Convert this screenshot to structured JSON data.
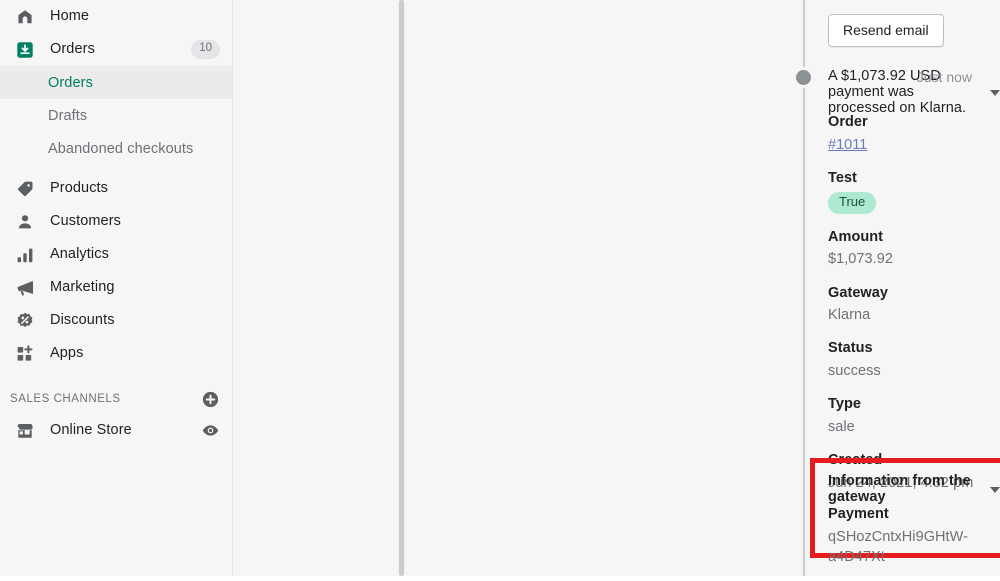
{
  "colors": {
    "sidebar_bg": "#f6f6f7",
    "accent_green": "#008060",
    "highlight_red": "#e81c1c",
    "badge_green": "#aee9d1",
    "link_blue": "#6b7bb5",
    "muted_text": "#6d7175"
  },
  "sidebar": {
    "items": [
      {
        "label": "Home",
        "icon": "home-icon",
        "badge": null
      },
      {
        "label": "Orders",
        "icon": "orders-inbox-icon",
        "badge": "10"
      },
      {
        "label": "Products",
        "icon": "products-tag-icon",
        "badge": null
      },
      {
        "label": "Customers",
        "icon": "customers-person-icon",
        "badge": null
      },
      {
        "label": "Analytics",
        "icon": "analytics-bars-icon",
        "badge": null
      },
      {
        "label": "Marketing",
        "icon": "marketing-megaphone-icon",
        "badge": null
      },
      {
        "label": "Discounts",
        "icon": "discounts-percent-icon",
        "badge": null
      },
      {
        "label": "Apps",
        "icon": "apps-grid-plus-icon",
        "badge": null
      }
    ],
    "sub_items": [
      {
        "label": "Orders",
        "active": true
      },
      {
        "label": "Drafts",
        "active": false
      },
      {
        "label": "Abandoned checkouts",
        "active": false
      }
    ],
    "sales_channels": {
      "title": "SALES CHANNELS",
      "add_icon": "plus-circle-icon",
      "items": [
        {
          "label": "Online Store",
          "icon": "online-store-shop-icon",
          "action_icon": "eye-icon"
        }
      ]
    }
  },
  "main": {
    "resend_button": "Resend email",
    "event": {
      "text": "A $1,073.92 USD payment was processed on Klarna.",
      "disclosure_icon": "chevron-down-icon",
      "timestamp": "Just now"
    },
    "fields": [
      {
        "label": "Order",
        "value": "#1011",
        "kind": "link"
      },
      {
        "label": "Test",
        "value": "True",
        "kind": "badge"
      },
      {
        "label": "Amount",
        "value": "$1,073.92",
        "kind": "text"
      },
      {
        "label": "Gateway",
        "value": "Klarna",
        "kind": "text"
      },
      {
        "label": "Status",
        "value": "success",
        "kind": "text"
      },
      {
        "label": "Type",
        "value": "sale",
        "kind": "text"
      },
      {
        "label": "Created",
        "value": "Jun 24, 2021, 4:32 pm",
        "kind": "text"
      }
    ],
    "gateway_section": {
      "title": "Information from the gateway",
      "disclosure_icon": "chevron-down-icon",
      "fields": [
        {
          "label": "Payment",
          "value": "qSHozCntxHi9GHtW-a4D47Xt"
        }
      ]
    }
  }
}
